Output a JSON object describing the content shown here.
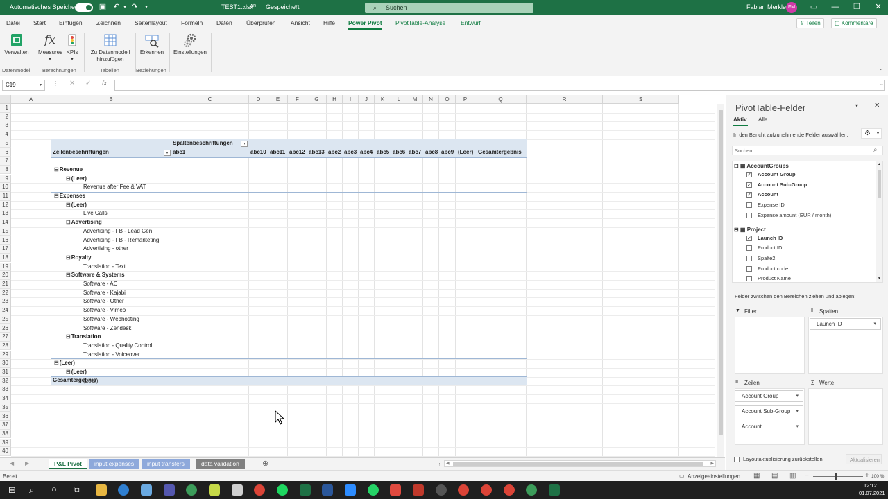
{
  "titlebar": {
    "autosave_label": "Automatisches Speichern",
    "autosave_state": "on",
    "filename": "TEST1.xlsx",
    "saved_status": "Gespeichert",
    "search_placeholder": "Suchen",
    "user_name": "Fabian Merkle",
    "user_initials": "FM"
  },
  "menu": {
    "tabs": [
      "Datei",
      "Start",
      "Einfügen",
      "Zeichnen",
      "Seitenlayout",
      "Formeln",
      "Daten",
      "Überprüfen",
      "Ansicht",
      "Hilfe",
      "Power Pivot",
      "PivotTable-Analyse",
      "Entwurf"
    ],
    "active": "Power Pivot",
    "share_label": "Teilen",
    "comments_label": "Kommentare"
  },
  "ribbon": {
    "buttons": {
      "manage": "Verwalten",
      "measures": "Measures",
      "kpis": "KPIs",
      "add_model_1": "Zu Datenmodell",
      "add_model_2": "hinzufügen",
      "detect": "Erkennen",
      "settings": "Einstellungen"
    },
    "groups": {
      "datamodel": "Datenmodell",
      "calculations": "Berechnungen",
      "tables": "Tabellen",
      "relations": "Beziehungen"
    }
  },
  "formula_bar": {
    "name_box": "C19",
    "fx": "fx",
    "formula": ""
  },
  "grid": {
    "columns": [
      "A",
      "B",
      "C",
      "D",
      "E",
      "F",
      "G",
      "H",
      "I",
      "J",
      "K",
      "L",
      "M",
      "N",
      "O",
      "P",
      "Q",
      "R",
      "S"
    ],
    "rows": [
      "1",
      "2",
      "3",
      "4",
      "5",
      "6",
      "7",
      "8",
      "9",
      "10",
      "11",
      "12",
      "13",
      "14",
      "15",
      "16",
      "17",
      "18",
      "19",
      "20",
      "21",
      "22",
      "23",
      "24",
      "25",
      "26",
      "27",
      "28",
      "29",
      "30",
      "31",
      "32",
      "33",
      "34",
      "35",
      "36",
      "37",
      "38",
      "39",
      "40"
    ]
  },
  "pivot": {
    "col_labels_header": "Spaltenbeschriftungen",
    "row_labels_header": "Zeilenbeschriftungen",
    "column_items": [
      "abc1",
      "abc10",
      "abc11",
      "abc12",
      "abc13",
      "abc2",
      "abc3",
      "abc4",
      "abc5",
      "abc6",
      "abc7",
      "abc8",
      "abc9",
      "(Leer)",
      "Gesamtergebnis"
    ],
    "rows": [
      {
        "label": "Revenue",
        "level": 0,
        "toggle": "⊟"
      },
      {
        "label": "(Leer)",
        "level": 1,
        "toggle": "⊟"
      },
      {
        "label": "Revenue after Fee & VAT",
        "level": 2,
        "toggle": ""
      },
      {
        "label": "Expenses",
        "level": 0,
        "toggle": "⊟"
      },
      {
        "label": "(Leer)",
        "level": 1,
        "toggle": "⊟"
      },
      {
        "label": "Live Calls",
        "level": 2,
        "toggle": ""
      },
      {
        "label": "Advertising",
        "level": 1,
        "toggle": "⊟"
      },
      {
        "label": "Advertising - FB - Lead Gen",
        "level": 2,
        "toggle": ""
      },
      {
        "label": "Advertising - FB - Remarketing",
        "level": 2,
        "toggle": ""
      },
      {
        "label": "Advertising - other",
        "level": 2,
        "toggle": ""
      },
      {
        "label": "Royalty",
        "level": 1,
        "toggle": "⊟"
      },
      {
        "label": "Translation - Text",
        "level": 2,
        "toggle": ""
      },
      {
        "label": "Software & Systems",
        "level": 1,
        "toggle": "⊟"
      },
      {
        "label": "Software - AC",
        "level": 2,
        "toggle": ""
      },
      {
        "label": "Software - Kajabi",
        "level": 2,
        "toggle": ""
      },
      {
        "label": "Software - Other",
        "level": 2,
        "toggle": ""
      },
      {
        "label": "Software - Vimeo",
        "level": 2,
        "toggle": ""
      },
      {
        "label": "Software - Webhosting",
        "level": 2,
        "toggle": ""
      },
      {
        "label": "Software - Zendesk",
        "level": 2,
        "toggle": ""
      },
      {
        "label": "Translation",
        "level": 1,
        "toggle": "⊟"
      },
      {
        "label": "Translation - Quality Control",
        "level": 2,
        "toggle": ""
      },
      {
        "label": "Translation - Voiceover",
        "level": 2,
        "toggle": ""
      },
      {
        "label": "(Leer)",
        "level": 0,
        "toggle": "⊟"
      },
      {
        "label": "(Leer)",
        "level": 1,
        "toggle": "⊟"
      },
      {
        "label": "(Leer)",
        "level": 2,
        "toggle": ""
      }
    ],
    "grand_total": "Gesamtergebnis"
  },
  "sheet_tabs": [
    {
      "label": "P&L Pivot",
      "active": true,
      "color": "#1e7145"
    },
    {
      "label": "input expenses",
      "active": false,
      "color": "#8ea9db"
    },
    {
      "label": "input transfers",
      "active": false,
      "color": "#8ea9db"
    },
    {
      "label": "data validation",
      "active": false,
      "color": "#808080"
    }
  ],
  "status": {
    "ready": "Bereit",
    "display_settings": "Anzeigeeinstellungen",
    "zoom": "100 %"
  },
  "pane": {
    "title": "PivotTable-Felder",
    "tab_active": "Aktiv",
    "tab_all": "Alle",
    "instruction": "In den Bericht aufzunehmende Felder auswählen:",
    "search_placeholder": "Suchen",
    "groups": [
      {
        "name": "AccountGroups",
        "fields": [
          {
            "label": "Account Group",
            "checked": true
          },
          {
            "label": "Account Sub-Group",
            "checked": true
          },
          {
            "label": "Account",
            "checked": true
          },
          {
            "label": "Expense ID",
            "checked": false
          },
          {
            "label": "Expense amount (EUR / month)",
            "checked": false
          }
        ]
      },
      {
        "name": "Project",
        "fields": [
          {
            "label": "Launch ID",
            "checked": true
          },
          {
            "label": "Product ID",
            "checked": false
          },
          {
            "label": "Spalte2",
            "checked": false
          },
          {
            "label": "Product code",
            "checked": false
          },
          {
            "label": "Product Name",
            "checked": false
          }
        ]
      }
    ],
    "areas_instruction": "Felder zwischen den Bereichen ziehen und ablegen:",
    "filter_label": "Filter",
    "columns_label": "Spalten",
    "rows_label": "Zeilen",
    "values_label": "Werte",
    "columns_fields": [
      "Launch ID"
    ],
    "rows_fields": [
      "Account Group",
      "Account Sub-Group",
      "Account"
    ],
    "defer_label": "Layoutaktualisierung zurückstellen",
    "update_button": "Aktualisieren"
  },
  "clock": {
    "time": "12:12",
    "date": "01.07.2021"
  }
}
